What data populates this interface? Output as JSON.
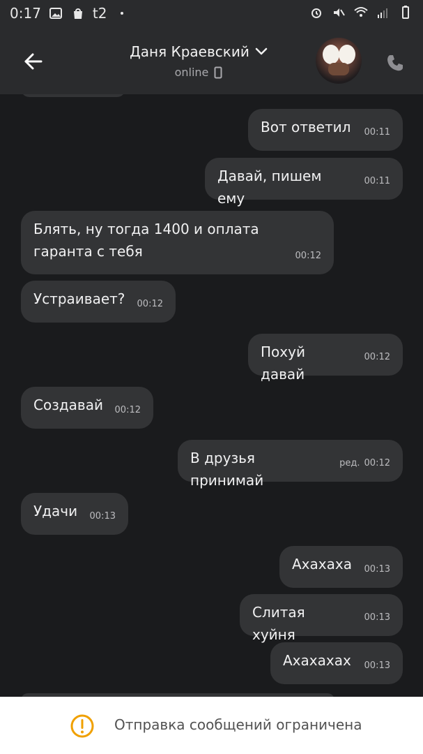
{
  "status_bar": {
    "time": "0:17",
    "carrier": "t2",
    "icons": [
      "image-icon",
      "shopping-bag-icon",
      "dot-icon",
      "alarm-icon",
      "mute-icon",
      "wifi-icon",
      "signal-icon",
      "battery-icon"
    ]
  },
  "header": {
    "contact_name": "Даня Краевский",
    "status": "online",
    "icons": [
      "back-arrow-icon",
      "chevron-down-icon",
      "phone-device-icon",
      "call-icon"
    ]
  },
  "messages": [
    {
      "side": "right",
      "text": "Вот ответил",
      "time": "00:11"
    },
    {
      "side": "right",
      "text": "Давай, пишем ему",
      "time": "00:11"
    },
    {
      "side": "left",
      "text": "Блять, ну тогда 1400 и оплата гаранта с тебя",
      "time": "00:12"
    },
    {
      "side": "left",
      "text": "Устраивает?",
      "time": "00:12"
    },
    {
      "side": "right",
      "text": "Похуй давай",
      "time": "00:12"
    },
    {
      "side": "left",
      "text": "Создавай",
      "time": "00:12"
    },
    {
      "side": "right",
      "text": "В друзья принимай",
      "time": "00:12",
      "edited": "ред."
    },
    {
      "side": "left",
      "text": "Удачи",
      "time": "00:13"
    },
    {
      "side": "right",
      "text": "Ахахаха",
      "time": "00:13"
    },
    {
      "side": "right",
      "text": "Слитая хуйня",
      "time": "00:13"
    },
    {
      "side": "right",
      "text": "Ахахахах",
      "time": "00:13"
    }
  ],
  "notice": {
    "text": "Отправка сообщений ограничена",
    "icon": "warning-icon"
  },
  "colors": {
    "background": "#1a1b1d",
    "header": "#2a2b2d",
    "bubble": "#333436",
    "warning": "#f0a000"
  }
}
